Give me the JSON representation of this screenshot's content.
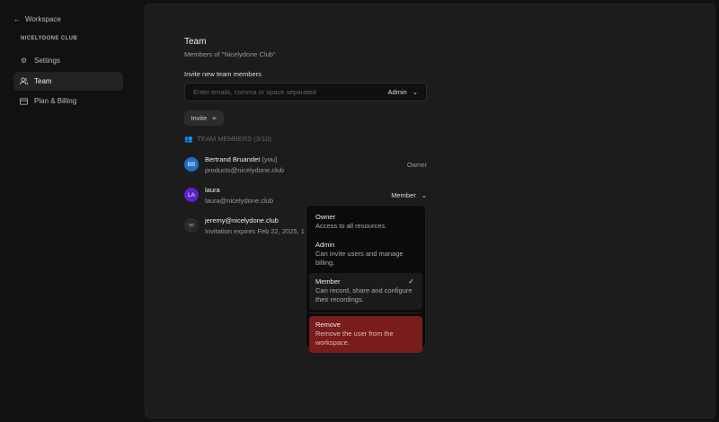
{
  "sidebar": {
    "back_label": "Workspace",
    "org": "NICELYDONE CLUB",
    "items": [
      {
        "label": "Settings",
        "icon": "gear-icon"
      },
      {
        "label": "Team",
        "icon": "users-icon",
        "active": true
      },
      {
        "label": "Plan & Billing",
        "icon": "credit-card-icon"
      }
    ]
  },
  "main": {
    "title": "Team",
    "subtitle": "Members of \"Nicelydone Club\"",
    "invite_label": "Invite new team members",
    "invite_placeholder": "Enter emails, comma or space separated",
    "invite_role": "Admin",
    "invite_button": "Invite",
    "members_header": "TEAM MEMBERS (3/10)",
    "members": [
      {
        "initials": "BB",
        "name": "Bertrand Bruandet",
        "you": "(you)",
        "email": "products@nicelydone.club",
        "role": "Owner",
        "color": "#1f6fc4"
      },
      {
        "initials": "LA",
        "name": "laura",
        "email": "laura@nicelydone.club",
        "role": "Member",
        "color": "#5b22c9"
      },
      {
        "name": "jeremy@nicelydone.club",
        "status": "Invitation expires Feb 22, 2025, 1"
      }
    ]
  },
  "role_menu": {
    "options": [
      {
        "title": "Owner",
        "desc": "Access to all resources."
      },
      {
        "title": "Admin",
        "desc": "Can invite users and manage billing."
      },
      {
        "title": "Member",
        "desc": "Can record, share and configure their recordings.",
        "selected": true
      }
    ],
    "remove": {
      "title": "Remove",
      "desc": "Remove the user from the workspace."
    },
    "accent_remove": "#7b1c1c"
  }
}
